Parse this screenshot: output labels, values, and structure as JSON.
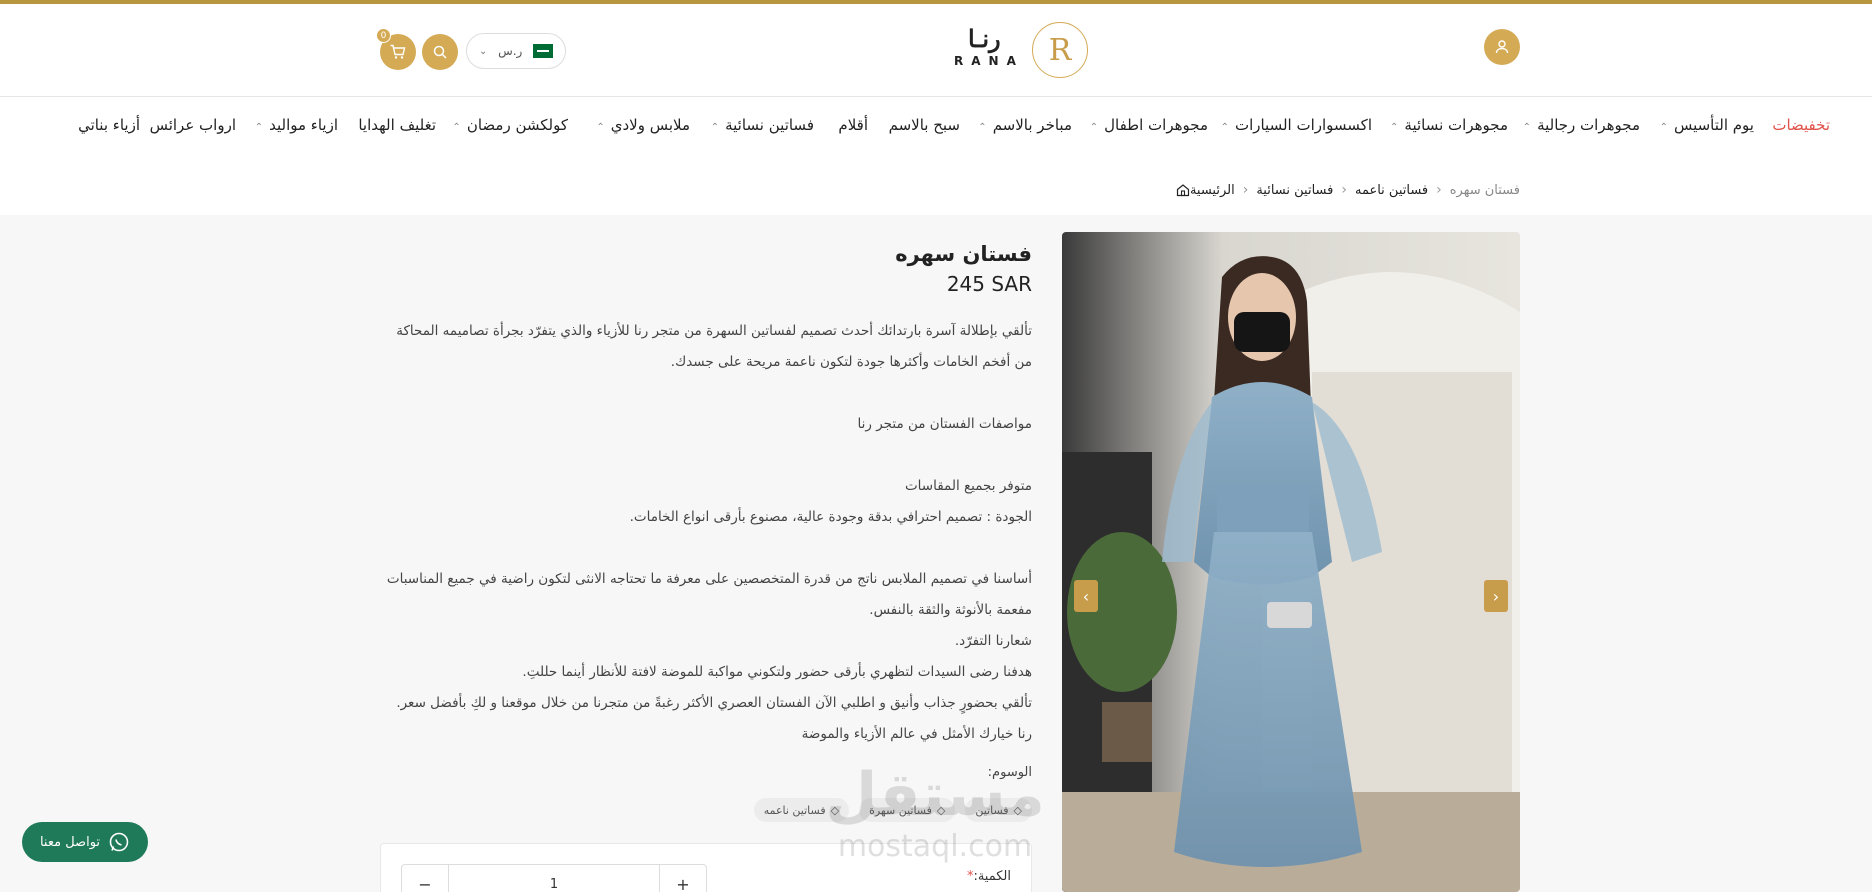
{
  "header": {
    "cart_count": "0",
    "currency_label": "ر.س",
    "logo_ar": "رنـا",
    "logo_en": "RANA",
    "logo_mark": "R"
  },
  "nav": {
    "items": [
      {
        "label": "تخفيضات",
        "has_chevron": false
      },
      {
        "label": "يوم التأسيس",
        "has_chevron": true
      },
      {
        "label": "مجوهرات رجالية",
        "has_chevron": true
      },
      {
        "label": "مجوهرات نسائية",
        "has_chevron": true
      },
      {
        "label": "اكسسوارات السيارات",
        "has_chevron": true
      },
      {
        "label": "مجوهرات اطفال",
        "has_chevron": true
      },
      {
        "label": "مباخر بالاسم",
        "has_chevron": true
      },
      {
        "label": "سبح بالاسم",
        "has_chevron": false
      },
      {
        "label": "أقلام",
        "has_chevron": false
      },
      {
        "label": "فساتين نسائية",
        "has_chevron": true
      },
      {
        "label": "ملابس ولادي",
        "has_chevron": true
      },
      {
        "label": "كولكشن رمضان",
        "has_chevron": true
      },
      {
        "label": "تغليف الهدايا",
        "has_chevron": false
      },
      {
        "label": "ازياء مواليد",
        "has_chevron": true
      },
      {
        "label": "ارواب عرائس",
        "has_chevron": false
      },
      {
        "label": "أزياء بناتي",
        "has_chevron": false
      }
    ]
  },
  "breadcrumb": {
    "home": "الرئيسية",
    "level1": "فساتين نسائية",
    "level2": "فساتين ناعمه",
    "current": "فستان سهره"
  },
  "product": {
    "title": "فستان سهره",
    "price": "245 SAR",
    "description": [
      "تألقي بإطلالة آسرة بارتدائك أحدث تصميم لفساتين السهرة من متجر رنا للأزياء والذي يتفرّد بجرأة تصاميمه المحاكة من أفخم الخامات وأكثرها جودة لتكون ناعمة مريحة على جسدك.",
      "",
      "مواصفات الفستان من متجر رنا",
      "",
      "متوفر بجميع المقاسات",
      "الجودة : تصميم احترافي بدقة وجودة عالية، مصنوع بأرقى انواع الخامات.",
      "",
      "أساسنا في تصميم الملابس ناتج من قدرة المتخصصين على معرفة ما تحتاجه الانثى لتكون راضية في جميع المناسبات مفعمة بالأنوثة والثقة بالنفس.",
      "شعارنا التفرّد.",
      "هدفنا رضى السيدات لتظهري بأرقى حضور ولتكوني مواكبة للموضة لافتة للأنظار أينما حللتِ.",
      "تألقي بحضورٍ جذاب وأنيق و اطلبي الآن الفستان العصري الأكثر رغبةً من متجرنا من خلال موقعنا و لكِ بأفضل سعر.",
      "رنا خيارك الأمثل في عالم الأزياء والموضة"
    ],
    "tags_label": "الوسوم:",
    "tags": [
      "فساتين ناعمه",
      "فساتين سهرة",
      "فساتين"
    ],
    "quantity_label": "الكمية:",
    "quantity_required_mark": "*",
    "quantity_value": "1"
  },
  "watermark": {
    "ar": "مستقل",
    "en": "mostaql.com"
  },
  "whatsapp": {
    "label": "تواصل معنا"
  },
  "colors": {
    "accent": "#d4aa55",
    "sale": "#e0524a",
    "whatsapp": "#1f7a5a"
  }
}
